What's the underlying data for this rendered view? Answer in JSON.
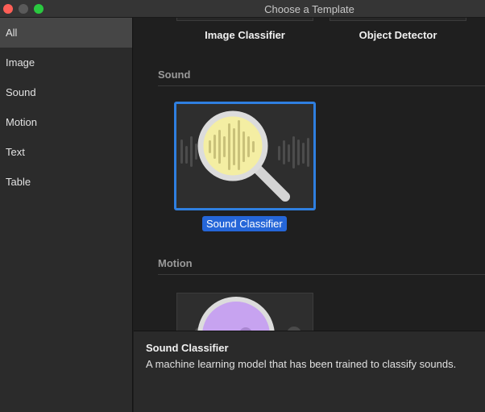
{
  "window": {
    "title": "Choose a Template"
  },
  "sidebar": {
    "items": [
      {
        "label": "All",
        "selected": true
      },
      {
        "label": "Image",
        "selected": false
      },
      {
        "label": "Sound",
        "selected": false
      },
      {
        "label": "Motion",
        "selected": false
      },
      {
        "label": "Text",
        "selected": false
      },
      {
        "label": "Table",
        "selected": false
      }
    ]
  },
  "main": {
    "image_section": {
      "templates": [
        {
          "label": "Image Classifier"
        },
        {
          "label": "Object Detector"
        }
      ]
    },
    "sound_section": {
      "heading": "Sound",
      "template": {
        "label": "Sound Classifier",
        "icon": "magnifier-waveform-icon",
        "selected": true
      }
    },
    "motion_section": {
      "heading": "Motion",
      "template": {
        "icon": "motion-icon"
      }
    }
  },
  "info": {
    "title": "Sound Classifier",
    "description": "A machine learning model that has been trained to classify sounds."
  },
  "colors": {
    "accent": "#2f7fe0",
    "selection": "#2566d8",
    "sound_icon_fill": "#f4eea3",
    "motion_icon_fill": "#c7a3f0"
  }
}
